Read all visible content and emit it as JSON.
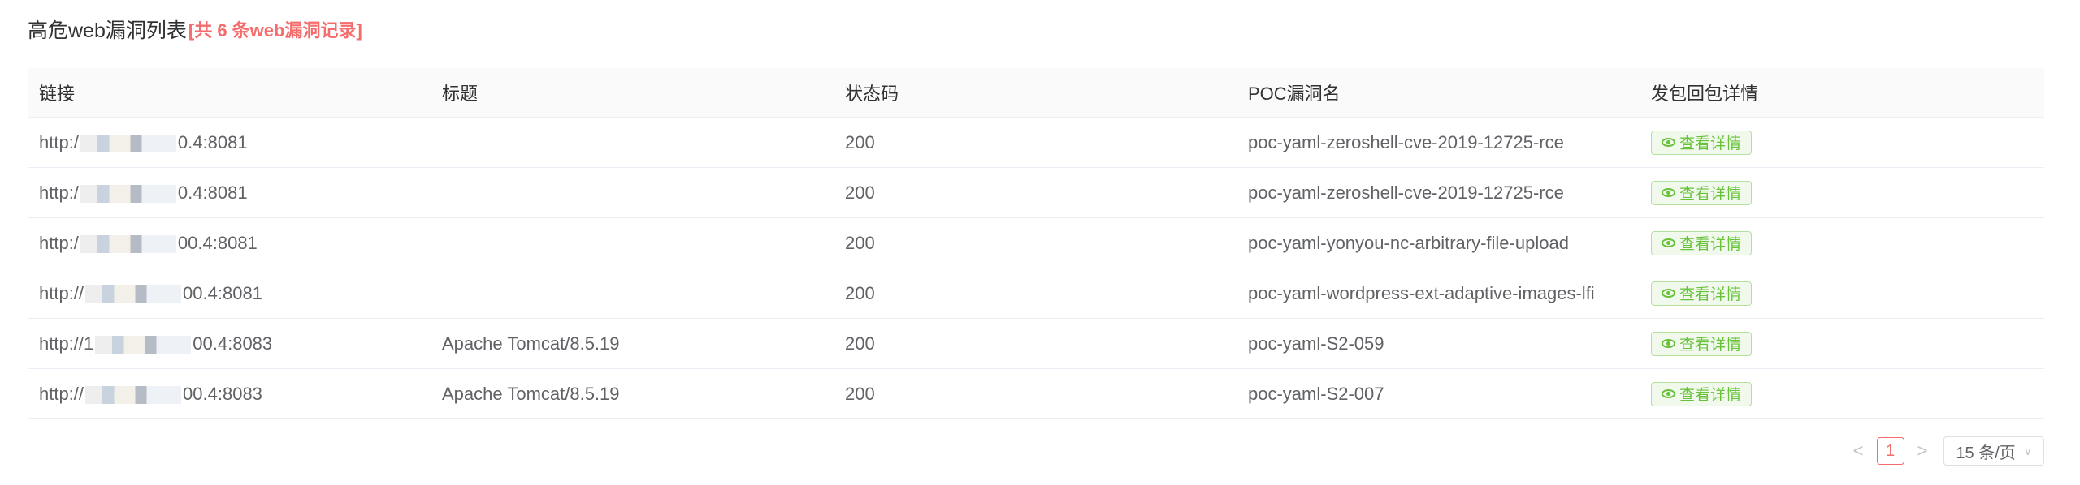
{
  "header": {
    "title": "高危web漏洞列表",
    "count_text": "[共 6 条web漏洞记录]"
  },
  "table": {
    "columns": [
      "链接",
      "标题",
      "状态码",
      "POC漏洞名",
      "发包回包详情"
    ],
    "rows": [
      {
        "link_prefix": "http:/",
        "link_suffix": "0.4:8081",
        "title": "",
        "status": "200",
        "poc": "poc-yaml-zeroshell-cve-2019-12725-rce",
        "detail": "查看详情"
      },
      {
        "link_prefix": "http:/",
        "link_suffix": "0.4:8081",
        "title": "",
        "status": "200",
        "poc": "poc-yaml-zeroshell-cve-2019-12725-rce",
        "detail": "查看详情"
      },
      {
        "link_prefix": "http:/",
        "link_suffix": "00.4:8081",
        "title": "",
        "status": "200",
        "poc": "poc-yaml-yonyou-nc-arbitrary-file-upload",
        "detail": "查看详情"
      },
      {
        "link_prefix": "http://",
        "link_suffix": "00.4:8081",
        "title": "",
        "status": "200",
        "poc": "poc-yaml-wordpress-ext-adaptive-images-lfi",
        "detail": "查看详情"
      },
      {
        "link_prefix": "http://1",
        "link_suffix": "00.4:8083",
        "title": "Apache Tomcat/8.5.19",
        "status": "200",
        "poc": "poc-yaml-S2-059",
        "detail": "查看详情"
      },
      {
        "link_prefix": "http://",
        "link_suffix": "00.4:8083",
        "title": "Apache Tomcat/8.5.19",
        "status": "200",
        "poc": "poc-yaml-S2-007",
        "detail": "查看详情"
      }
    ]
  },
  "pagination": {
    "prev": "<",
    "current_page": "1",
    "next": ">",
    "page_size": "15 条/页"
  },
  "colors": {
    "accent_red": "#f56c6c",
    "success_green": "#67c23a",
    "border": "#ebeef5"
  }
}
